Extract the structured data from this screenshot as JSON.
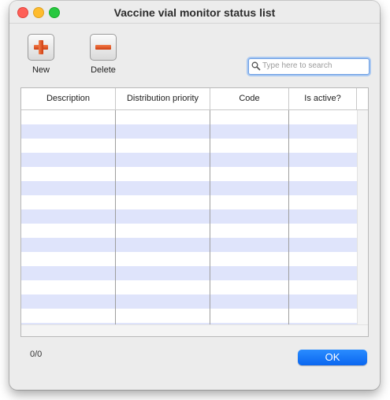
{
  "window": {
    "title": "Vaccine vial monitor status list"
  },
  "toolbar": {
    "new_label": "New",
    "delete_label": "Delete"
  },
  "search": {
    "placeholder": "Type here to search",
    "value": ""
  },
  "table": {
    "columns": [
      "Description",
      "Distribution priority",
      "Code",
      "Is active?"
    ],
    "rows": []
  },
  "footer": {
    "record_count": "0/0",
    "ok_label": "OK"
  },
  "colors": {
    "accent": "#0a66f0",
    "row_alt": "#dfe4fb",
    "icon_red": "#cf3f12",
    "close": "#fe5f57",
    "minimize": "#febc2e",
    "maximize": "#28c840"
  }
}
